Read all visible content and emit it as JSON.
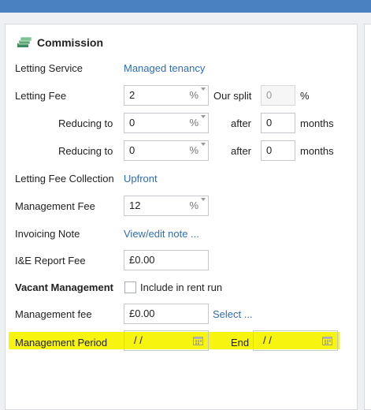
{
  "section": {
    "title": "Commission",
    "icon": "money-stack-icon"
  },
  "letting_service": {
    "label": "Letting Service",
    "value": "Managed tenancy"
  },
  "letting_fee": {
    "label": "Letting Fee",
    "value": "2",
    "unit": "%",
    "split_label": "Our split",
    "split_value": "0",
    "split_unit": "%"
  },
  "reducing": [
    {
      "label": "Reducing to",
      "value": "0",
      "unit": "%",
      "after_label": "after",
      "months_value": "0",
      "months_label": "months"
    },
    {
      "label": "Reducing to",
      "value": "0",
      "unit": "%",
      "after_label": "after",
      "months_value": "0",
      "months_label": "months"
    }
  ],
  "letting_fee_collection": {
    "label": "Letting Fee Collection",
    "value": "Upfront"
  },
  "management_fee_pct": {
    "label": "Management Fee",
    "value": "12",
    "unit": "%"
  },
  "invoicing_note": {
    "label": "Invoicing Note",
    "link": "View/edit note ..."
  },
  "ie_report_fee": {
    "label": "I&E Report Fee",
    "value": "£0.00"
  },
  "vacant_management": {
    "label": "Vacant Management",
    "checkbox_label": "Include in rent run"
  },
  "management_fee_amount": {
    "label": "Management fee",
    "value": "£0.00",
    "link": "Select ..."
  },
  "management_period": {
    "label": "Management Period",
    "start_value": "/ /",
    "end_label": "End",
    "end_value": "/ /"
  },
  "colors": {
    "topbar": "#4a82bf",
    "link": "#2f6db5",
    "highlight": "#f7f410"
  }
}
